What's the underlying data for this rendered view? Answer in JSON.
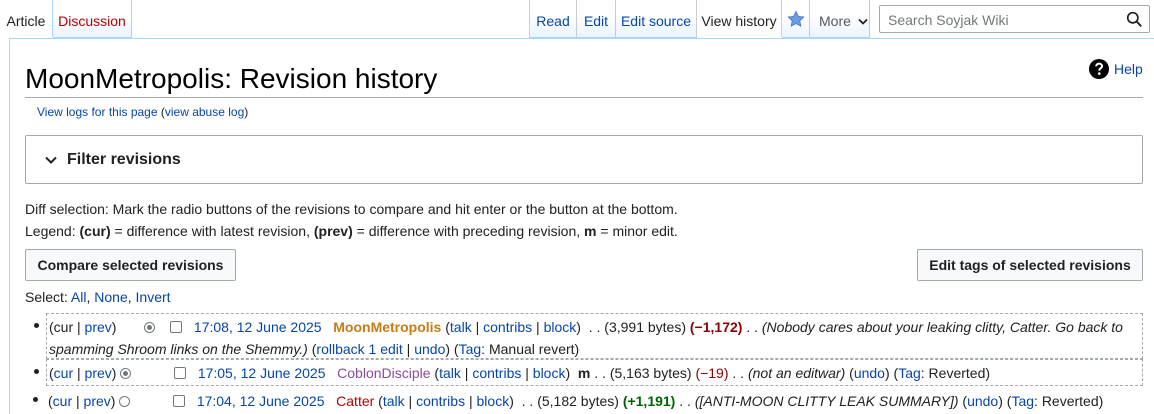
{
  "tabs": {
    "left": [
      {
        "label": "Article"
      },
      {
        "label": "Discussion"
      }
    ],
    "right": [
      {
        "label": "Read"
      },
      {
        "label": "Edit"
      },
      {
        "label": "Edit source"
      },
      {
        "label": "View history"
      },
      {
        "label": "More"
      }
    ]
  },
  "search": {
    "placeholder": "Search Soyjak Wiki"
  },
  "page": {
    "title": "MoonMetropolis: Revision history",
    "help": "Help",
    "logs_link": "View logs for this page",
    "abuse_log_link": "view abuse log"
  },
  "filter": {
    "label": "Filter revisions"
  },
  "diff_selection_text": "Diff selection: Mark the radio buttons of the revisions to compare and hit enter or the button at the bottom.",
  "legend": {
    "prefix": "Legend: ",
    "cur": "(cur)",
    "cur_desc": " = difference with latest revision, ",
    "prev": "(prev)",
    "prev_desc": " = difference with preceding revision, ",
    "m": "m",
    "m_desc": " = minor edit."
  },
  "buttons": {
    "compare": "Compare selected revisions",
    "edit_tags": "Edit tags of selected revisions"
  },
  "select": {
    "label": "Select: ",
    "all": "All",
    "none": "None",
    "invert": "Invert"
  },
  "revisions": [
    {
      "cur": "cur",
      "prev": "prev",
      "timestamp": "17:08, 12 June 2025",
      "user": "MoonMetropolis",
      "talk": "talk",
      "contribs": "contribs",
      "block": "block",
      "bytes": "(3,991 bytes)",
      "diff": "(−1,172)",
      "comment": "(Nobody cares about your leaking clitty, Catter. Go back to spamming Shroom links on the Shemmy.)",
      "rollback": "rollback 1 edit",
      "undo": "undo",
      "tag_label": "Tag",
      "tag": "Manual revert"
    },
    {
      "cur": "cur",
      "prev": "prev",
      "timestamp": "17:05, 12 June 2025",
      "user": "CoblonDisciple",
      "talk": "talk",
      "contribs": "contribs",
      "block": "block",
      "minor": "m",
      "bytes": "(5,163 bytes)",
      "diff": "(−19)",
      "comment": "(not an editwar)",
      "undo": "undo",
      "tag_label": "Tag",
      "tag": "Reverted"
    },
    {
      "cur": "cur",
      "prev": "prev",
      "timestamp": "17:04, 12 June 2025",
      "user": "Catter",
      "talk": "talk",
      "contribs": "contribs",
      "block": "block",
      "bytes": "(5,182 bytes)",
      "diff": "(+1,191)",
      "comment": "([ANTI-MOON CLITTY LEAK SUMMARY])",
      "undo": "undo",
      "tag_label": "Tag",
      "tag": "Reverted"
    }
  ],
  "icons": {
    "search": "search-icon",
    "watch": "star-icon",
    "help": "help-icon",
    "filter_toggle": "chevron-down-icon",
    "more_menu": "chevron-down-icon"
  },
  "colors": {
    "link": "#0645ad",
    "discussion_red": "#ba0000",
    "watch_star": "#36c"
  }
}
